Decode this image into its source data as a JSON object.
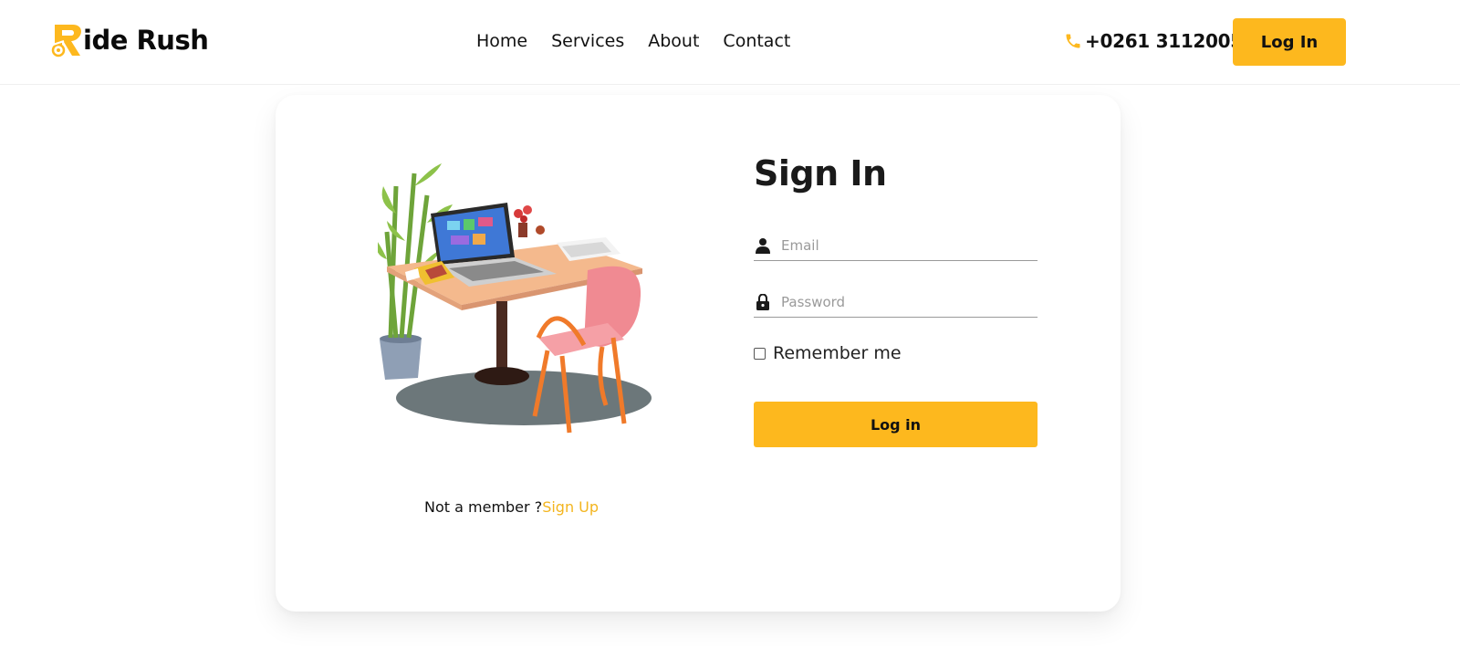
{
  "brand": {
    "name": "ide Rush",
    "accent": "#fdb81e"
  },
  "nav": {
    "items": [
      "Home",
      "Services",
      "About",
      "Contact"
    ]
  },
  "header": {
    "phone": "+0261 3112005",
    "login_label": "Log In",
    "phone_icon": "phone-icon"
  },
  "signin": {
    "title": "Sign In",
    "email_placeholder": "Email",
    "password_placeholder": "Password",
    "remember_label": "Remember me",
    "submit_label": "Log in"
  },
  "signup": {
    "prompt": "Not a member ?",
    "link_label": "Sign Up"
  }
}
